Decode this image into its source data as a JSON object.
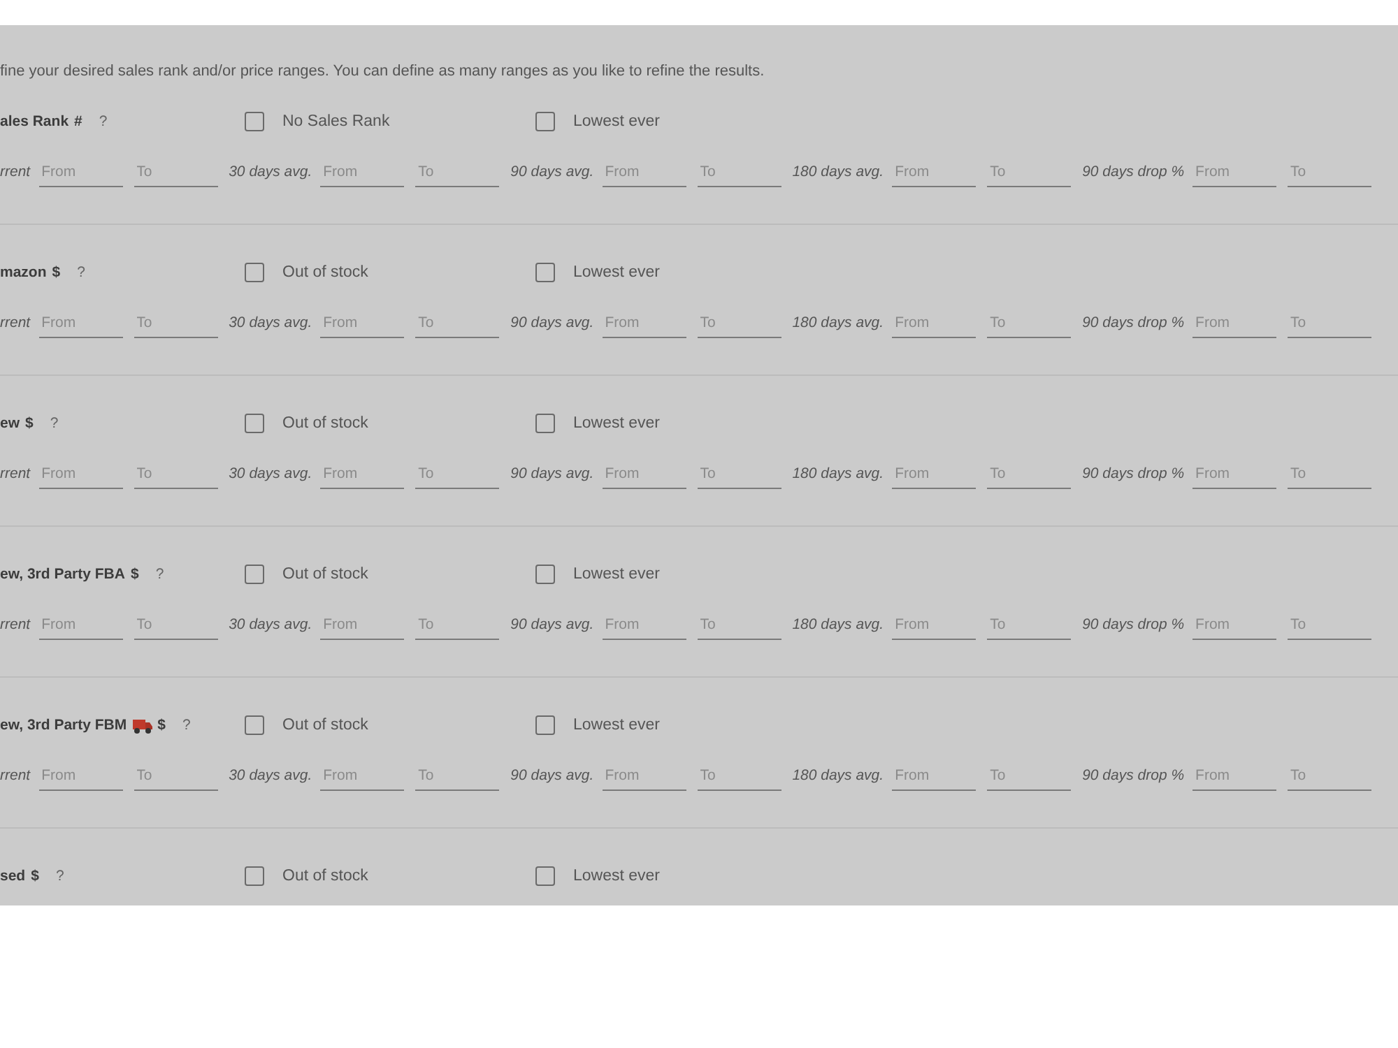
{
  "intro": "fine your desired sales rank and/or price ranges. You can define as many ranges as you like to refine the results.",
  "sections": [
    {
      "label": "ales Rank",
      "truck_icon": false,
      "unit": "#",
      "help": "?",
      "options": [
        {
          "label": "No Sales Rank",
          "checked": false
        },
        {
          "label": "Lowest ever",
          "checked": false
        }
      ],
      "ranges": [
        {
          "label": "rrent",
          "from": {
            "placeholder": "From"
          },
          "to": {
            "placeholder": "To"
          }
        },
        {
          "label": "30 days avg.",
          "from": {
            "placeholder": "From"
          },
          "to": {
            "placeholder": "To"
          }
        },
        {
          "label": "90 days avg.",
          "from": {
            "placeholder": "From"
          },
          "to": {
            "placeholder": "To"
          }
        },
        {
          "label": "180 days avg.",
          "from": {
            "placeholder": "From"
          },
          "to": {
            "placeholder": "To"
          }
        },
        {
          "label": "90 days drop %",
          "from": {
            "placeholder": "From"
          },
          "to": {
            "placeholder": "To"
          }
        }
      ]
    },
    {
      "label": "mazon",
      "truck_icon": false,
      "unit": "$",
      "help": "?",
      "options": [
        {
          "label": "Out of stock",
          "checked": false
        },
        {
          "label": "Lowest ever",
          "checked": false
        }
      ],
      "ranges": [
        {
          "label": "rrent",
          "from": {
            "placeholder": "From"
          },
          "to": {
            "placeholder": "To"
          }
        },
        {
          "label": "30 days avg.",
          "from": {
            "placeholder": "From"
          },
          "to": {
            "placeholder": "To"
          }
        },
        {
          "label": "90 days avg.",
          "from": {
            "placeholder": "From"
          },
          "to": {
            "placeholder": "To"
          }
        },
        {
          "label": "180 days avg.",
          "from": {
            "placeholder": "From"
          },
          "to": {
            "placeholder": "To"
          }
        },
        {
          "label": "90 days drop %",
          "from": {
            "placeholder": "From"
          },
          "to": {
            "placeholder": "To"
          }
        }
      ]
    },
    {
      "label": "ew",
      "truck_icon": false,
      "unit": "$",
      "help": "?",
      "options": [
        {
          "label": "Out of stock",
          "checked": false
        },
        {
          "label": "Lowest ever",
          "checked": false
        }
      ],
      "ranges": [
        {
          "label": "rrent",
          "from": {
            "placeholder": "From"
          },
          "to": {
            "placeholder": "To"
          }
        },
        {
          "label": "30 days avg.",
          "from": {
            "placeholder": "From"
          },
          "to": {
            "placeholder": "To"
          }
        },
        {
          "label": "90 days avg.",
          "from": {
            "placeholder": "From"
          },
          "to": {
            "placeholder": "To"
          }
        },
        {
          "label": "180 days avg.",
          "from": {
            "placeholder": "From"
          },
          "to": {
            "placeholder": "To"
          }
        },
        {
          "label": "90 days drop %",
          "from": {
            "placeholder": "From"
          },
          "to": {
            "placeholder": "To"
          }
        }
      ]
    },
    {
      "label": "ew, 3rd Party FBA",
      "truck_icon": false,
      "unit": "$",
      "help": "?",
      "options": [
        {
          "label": "Out of stock",
          "checked": false
        },
        {
          "label": "Lowest ever",
          "checked": false
        }
      ],
      "ranges": [
        {
          "label": "rrent",
          "from": {
            "placeholder": "From"
          },
          "to": {
            "placeholder": "To"
          }
        },
        {
          "label": "30 days avg.",
          "from": {
            "placeholder": "From"
          },
          "to": {
            "placeholder": "To"
          }
        },
        {
          "label": "90 days avg.",
          "from": {
            "placeholder": "From"
          },
          "to": {
            "placeholder": "To"
          }
        },
        {
          "label": "180 days avg.",
          "from": {
            "placeholder": "From"
          },
          "to": {
            "placeholder": "To"
          }
        },
        {
          "label": "90 days drop %",
          "from": {
            "placeholder": "From"
          },
          "to": {
            "placeholder": "To"
          }
        }
      ]
    },
    {
      "label": "ew, 3rd Party FBM",
      "truck_icon": true,
      "unit": "$",
      "help": "?",
      "options": [
        {
          "label": "Out of stock",
          "checked": false
        },
        {
          "label": "Lowest ever",
          "checked": false
        }
      ],
      "ranges": [
        {
          "label": "rrent",
          "from": {
            "placeholder": "From"
          },
          "to": {
            "placeholder": "To"
          }
        },
        {
          "label": "30 days avg.",
          "from": {
            "placeholder": "From"
          },
          "to": {
            "placeholder": "To"
          }
        },
        {
          "label": "90 days avg.",
          "from": {
            "placeholder": "From"
          },
          "to": {
            "placeholder": "To"
          }
        },
        {
          "label": "180 days avg.",
          "from": {
            "placeholder": "From"
          },
          "to": {
            "placeholder": "To"
          }
        },
        {
          "label": "90 days drop %",
          "from": {
            "placeholder": "From"
          },
          "to": {
            "placeholder": "To"
          }
        }
      ]
    },
    {
      "label": "sed",
      "truck_icon": false,
      "unit": "$",
      "help": "?",
      "options": [
        {
          "label": "Out of stock",
          "checked": false
        },
        {
          "label": "Lowest ever",
          "checked": false
        }
      ]
    }
  ]
}
